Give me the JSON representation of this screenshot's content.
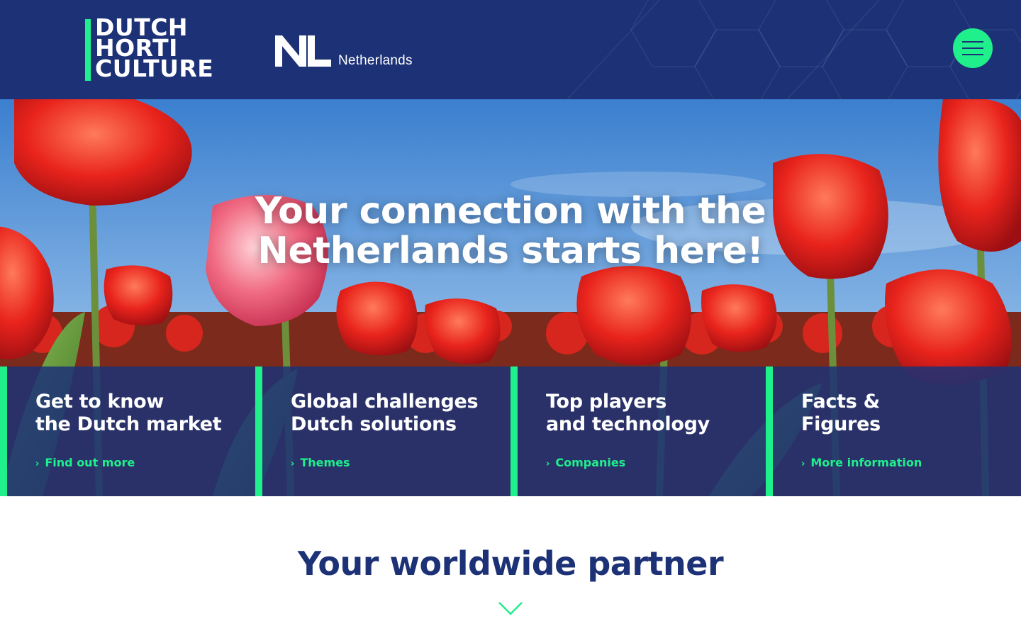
{
  "brand": {
    "logo_lines": [
      "DUTCH",
      "HORTI",
      "CULTURE"
    ],
    "partner_logo_text": "Netherlands",
    "accent_color": "#1ff08c",
    "primary_color": "#1d3276"
  },
  "header": {
    "menu_icon": "hamburger-icon"
  },
  "hero": {
    "title_line1": "Your connection with the",
    "title_line2": "Netherlands starts here!"
  },
  "cards": [
    {
      "title_line1": "Get to know",
      "title_line2": "the Dutch market",
      "link_label": "Find out more"
    },
    {
      "title_line1": "Global challenges",
      "title_line2": "Dutch solutions",
      "link_label": "Themes"
    },
    {
      "title_line1": "Top players",
      "title_line2": "and technology",
      "link_label": "Companies"
    },
    {
      "title_line1": "Facts &",
      "title_line2": "Figures",
      "link_label": "More information"
    }
  ],
  "partner_section": {
    "title": "Your worldwide partner",
    "scroll_icon": "chevron-down-icon"
  }
}
